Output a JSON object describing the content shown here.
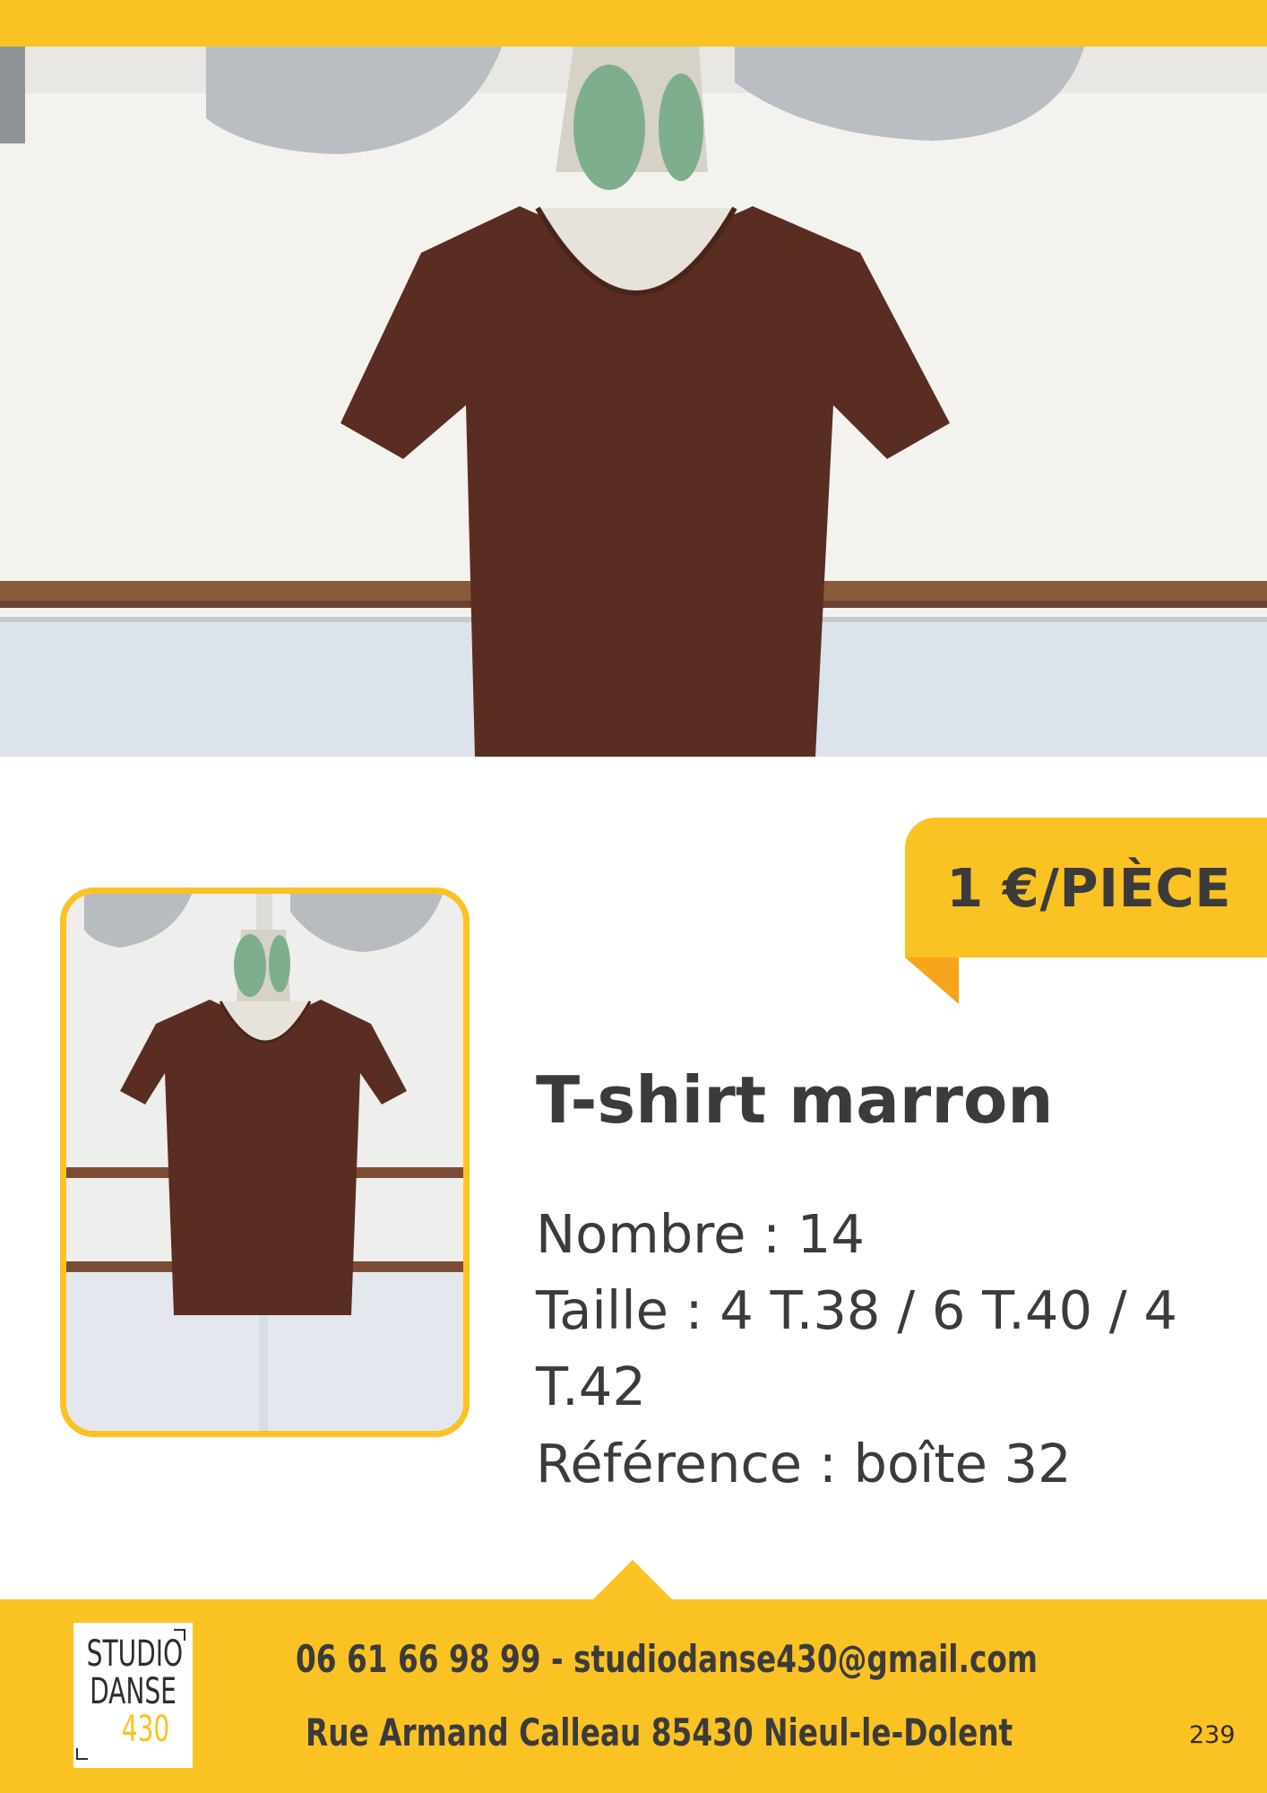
{
  "price": {
    "label": "1 €/PIÈCE"
  },
  "product": {
    "title": "T-shirt marron",
    "count": "Nombre : 14",
    "size_line1": "Taille : 4 T.38 / 6 T.40 / 4",
    "size_line2": "T.42",
    "reference": "Référence : boîte 32"
  },
  "footer": {
    "logo_line1": "STUDIO",
    "logo_line2": "DANSE",
    "logo_line3": "430",
    "contact": "06 61 66 98 99 - studiodanse430@gmail.com",
    "address": "Rue Armand Calleau 85430 Nieul-le-Dolent",
    "page_number": "239"
  },
  "colors": {
    "accent": "#FBC223",
    "text": "#3b3b3b",
    "shirt": "#5a2d22"
  },
  "images": {
    "hero": "mannequin-brown-tshirt-photo",
    "thumbnail": "mannequin-brown-tshirt-full-photo"
  }
}
